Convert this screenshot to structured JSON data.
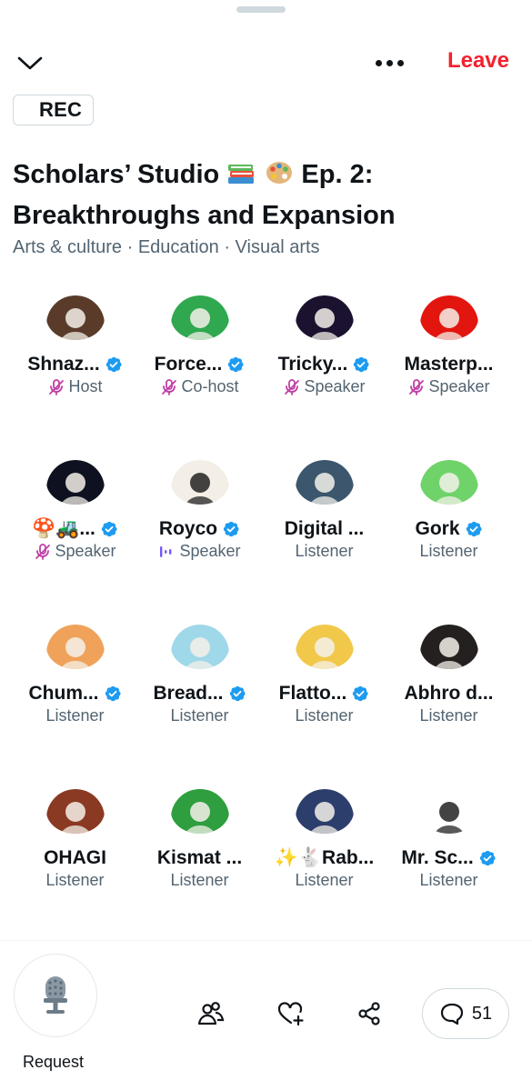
{
  "header": {
    "leave_label": "Leave",
    "rec_label": "REC"
  },
  "space": {
    "title": "Scholars’ Studio",
    "title_suffix": "Ep. 2:",
    "title_line2": "Breakthroughs and Expansion",
    "title_emojis": [
      "books-icon",
      "palette-icon"
    ],
    "topics": "Arts & culture · Education · Visual arts"
  },
  "participants": [
    {
      "name": "Shnaz...",
      "role": "Host",
      "verified": true,
      "mic": "muted",
      "avatar_icon": "girl-reading-illustration",
      "avatar_color": "#5a3b2a"
    },
    {
      "name": "Force...",
      "role": "Co-host",
      "verified": true,
      "mic": "muted",
      "avatar_icon": "sombrero-cartoon",
      "avatar_color": "#2fa84f"
    },
    {
      "name": "Tricky...",
      "role": "Speaker",
      "verified": true,
      "mic": "muted",
      "avatar_icon": "tricky-logo",
      "avatar_color": "#1b1230"
    },
    {
      "name": "Masterp...",
      "role": "Speaker",
      "verified": false,
      "mic": "muted",
      "avatar_icon": "hooded-figure",
      "avatar_color": "#e3150f"
    },
    {
      "name": "🍄🚜...",
      "role": "Speaker",
      "verified": true,
      "mic": "muted",
      "avatar_icon": "wolf-sketch",
      "avatar_color": "#0e1220"
    },
    {
      "name": "Royco",
      "role": "Speaker",
      "verified": true,
      "mic": "speaking",
      "avatar_icon": "pirate-cartoon",
      "avatar_color": "#f3efe6"
    },
    {
      "name": "Digital ...",
      "role": "Listener",
      "verified": false,
      "mic": "none",
      "avatar_icon": "lighthouse-storm",
      "avatar_color": "#3b566d"
    },
    {
      "name": "Gork",
      "role": "Listener",
      "verified": true,
      "mic": "none",
      "avatar_icon": "green-creature",
      "avatar_color": "#6fd36a"
    },
    {
      "name": "Chum...",
      "role": "Listener",
      "verified": true,
      "mic": "none",
      "avatar_icon": "pink-character",
      "avatar_color": "#f0a25a"
    },
    {
      "name": "Bread...",
      "role": "Listener",
      "verified": true,
      "mic": "none",
      "avatar_icon": "doodle-figure",
      "avatar_color": "#9fd8e8"
    },
    {
      "name": "Flatto...",
      "role": "Listener",
      "verified": true,
      "mic": "none",
      "avatar_icon": "abstract-portrait",
      "avatar_color": "#f2c84b"
    },
    {
      "name": "Abhro d...",
      "role": "Listener",
      "verified": false,
      "mic": "none",
      "avatar_icon": "bald-hero",
      "avatar_color": "#23201f"
    },
    {
      "name": "OHAGI",
      "role": "Listener",
      "verified": false,
      "mic": "none",
      "avatar_icon": "raccoon-sketch",
      "avatar_color": "#8a3a22"
    },
    {
      "name": "Kismat ...",
      "role": "Listener",
      "verified": false,
      "mic": "none",
      "avatar_icon": "woman-photo",
      "avatar_color": "#2e9e3f"
    },
    {
      "name": "✨🐇Rab...",
      "role": "Listener",
      "verified": false,
      "mic": "none",
      "avatar_icon": "hat-character",
      "avatar_color": "#2c3e6b"
    },
    {
      "name": "Mr. Sc...",
      "role": "Listener",
      "verified": true,
      "mic": "none",
      "avatar_icon": "cowboy-ghost-sketch",
      "avatar_color": "#ffffff"
    }
  ],
  "footer": {
    "request_label": "Request",
    "comments_count": "51"
  },
  "colors": {
    "accent_red": "#f4212e",
    "verified_blue": "#1d9bf0",
    "muted_pink": "#c03fa5",
    "speaking_purple": "#7856ff",
    "secondary_text": "#536471"
  }
}
